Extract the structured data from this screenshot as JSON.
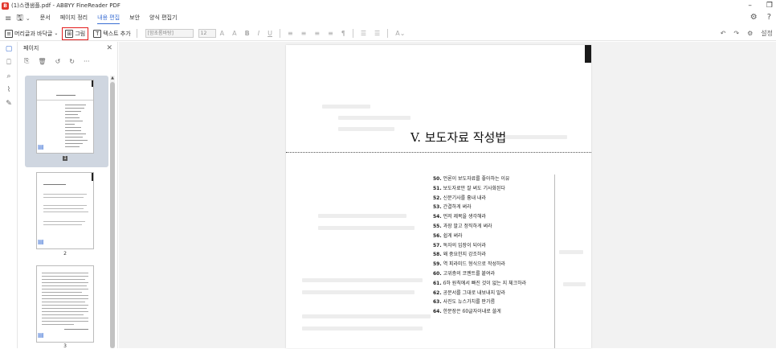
{
  "window": {
    "title": "(1)스캔샘플.pdf - ABBYY FineReader PDF",
    "logo": "B"
  },
  "menubar": {
    "items": [
      {
        "label": "문서",
        "active": false
      },
      {
        "label": "페이지 정리",
        "active": false
      },
      {
        "label": "내용 편집",
        "active": true
      },
      {
        "label": "보안",
        "active": false
      },
      {
        "label": "양식 편집기",
        "active": false
      }
    ]
  },
  "toolbar": {
    "header_footer": "머리글과 바닥글",
    "image": "그림",
    "add_text": "텍스트 추가",
    "font": "[함초롬바탕]",
    "font_size": "12",
    "settings": "설정"
  },
  "pages_panel": {
    "title": "페이지",
    "thumbnails": [
      {
        "number": "1",
        "selected": true
      },
      {
        "number": "2",
        "selected": false
      },
      {
        "number": "3",
        "selected": false
      }
    ]
  },
  "document": {
    "title": "V. 보도자료 작성법",
    "toc": [
      {
        "num": "50.",
        "text": "언론이 보도자료를 좋아하는 이유"
      },
      {
        "num": "51.",
        "text": "보도자료만 잘 써도 기사화된다"
      },
      {
        "num": "52.",
        "text": "신문기사를 흉내 내라"
      },
      {
        "num": "53.",
        "text": "간결하게 써라"
      },
      {
        "num": "54.",
        "text": "먼저 제목을 생각해라"
      },
      {
        "num": "55.",
        "text": "과장 말고 정직하게 써라"
      },
      {
        "num": "56.",
        "text": "쉽게 써라"
      },
      {
        "num": "57.",
        "text": "독자의 입장이 되어라"
      },
      {
        "num": "58.",
        "text": "왜 중요한지 강조하라"
      },
      {
        "num": "59.",
        "text": "역 피라미드 형식으로 작성하라"
      },
      {
        "num": "60.",
        "text": "고위층의 코멘트를 붙여라"
      },
      {
        "num": "61.",
        "text": "6하 원칙에서 빠진 것이 없는 지 체크하라"
      },
      {
        "num": "62.",
        "text": "공문서를 그대로 내보내지 말라"
      },
      {
        "num": "63.",
        "text": "사진도 뉴스가치를 판가름"
      },
      {
        "num": "64.",
        "text": "한문장은 60글자이내로 쓸게"
      }
    ]
  }
}
